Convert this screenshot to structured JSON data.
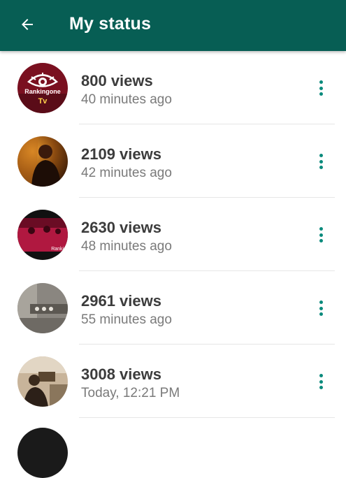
{
  "header": {
    "title": "My status",
    "back_icon": "arrow-left-icon",
    "color": "#075e54"
  },
  "statuses": [
    {
      "views": "800 views",
      "time": "40 minutes ago",
      "thumbnail_text_line1": "Rankingone",
      "thumbnail_text_line2": "Tv"
    },
    {
      "views": "2109 views",
      "time": "42 minutes ago"
    },
    {
      "views": "2630 views",
      "time": "48 minutes ago",
      "thumbnail_text_line1": "Rankin"
    },
    {
      "views": "2961 views",
      "time": "55 minutes ago"
    },
    {
      "views": "3008 views",
      "time": "Today, 12:21 PM"
    }
  ],
  "menu_icon": "more-vertical-icon",
  "accent_color": "#0a8a7c"
}
